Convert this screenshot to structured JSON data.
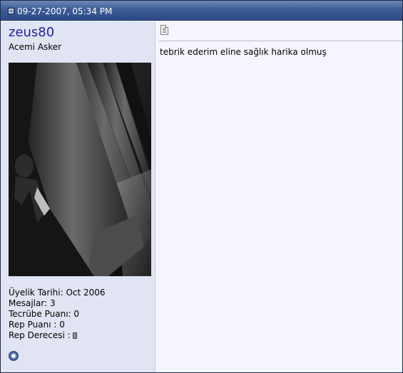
{
  "post": {
    "date": "09-27-2007, 05:34 PM",
    "message": "tebrik ederim eline sağlık harika olmuş"
  },
  "user": {
    "name": "zeus80",
    "title": "Acemi Asker",
    "stats": {
      "join_date": "Üyelik Tarihi: Oct 2006",
      "posts": "Mesajlar: 3",
      "experience": "Tecrübe Puanı: 0",
      "rep_points": "Rep Puanı : 0",
      "rep_level": "Rep Derecesi :"
    }
  },
  "icons": {
    "header": "post-document-icon",
    "message": "message-page-icon",
    "online_status": "offline-status-icon"
  },
  "colors": {
    "header": "#2c4b86",
    "username": "#22229c",
    "user_panel": "#e1e4f2",
    "message_area": "#f5f5ff"
  }
}
